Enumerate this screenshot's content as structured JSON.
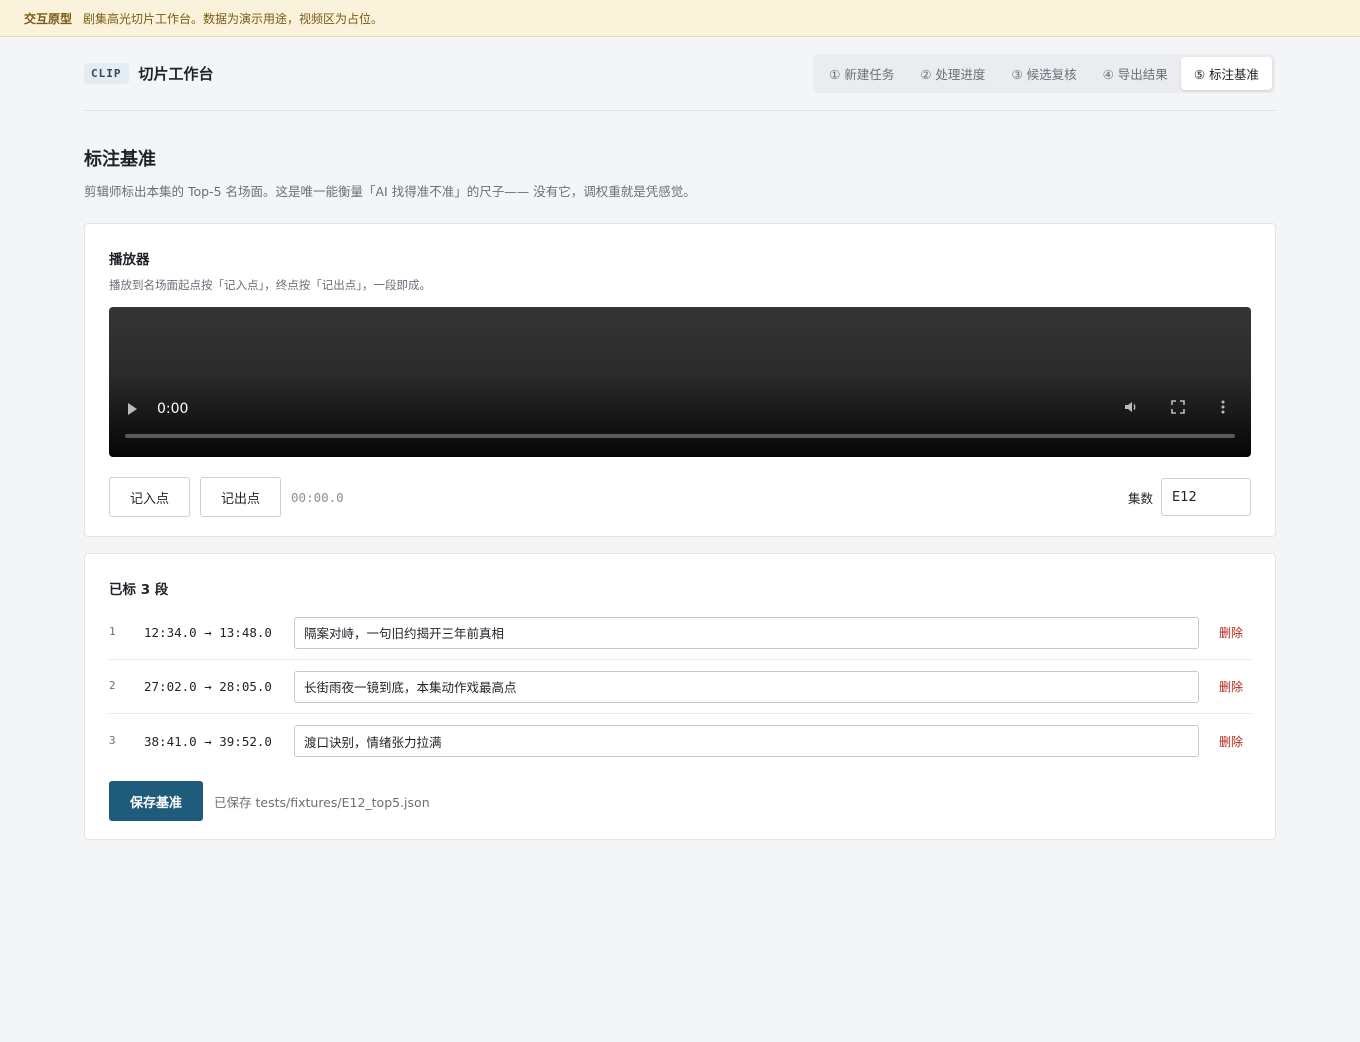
{
  "banner": {
    "tag": "交互原型",
    "message": "剧集高光切片工作台。数据为演示用途，视频区为占位。"
  },
  "header": {
    "brand_code": "CLIP",
    "app_name": "切片工作台",
    "tabs": [
      {
        "label": "① 新建任务",
        "active": false
      },
      {
        "label": "② 处理进度",
        "active": false
      },
      {
        "label": "③ 候选复核",
        "active": false
      },
      {
        "label": "④ 导出结果",
        "active": false
      },
      {
        "label": "⑤ 标注基准",
        "active": true
      }
    ]
  },
  "page": {
    "title": "标注基准",
    "description": "剪辑师标出本集的 Top-5 名场面。这是唯一能衡量「AI 找得准不准」的尺子—— 没有它，调权重就是凭感觉。"
  },
  "player": {
    "title": "播放器",
    "hint": "播放到名场面起点按「记入点」，终点按「记出点」，一段即成。",
    "video_time": "0:00",
    "mark_in_label": "记入点",
    "mark_out_label": "记出点",
    "current_timecode": "00:00.0",
    "episode_label": "集数",
    "episode_value": "E12"
  },
  "segments": {
    "title": "已标 3 段",
    "items": [
      {
        "index": "1",
        "range": "12:34.0 → 13:48.0",
        "title": "隔案对峙，一句旧约揭开三年前真相",
        "delete_label": "删除"
      },
      {
        "index": "2",
        "range": "27:02.0 → 28:05.0",
        "title": "长街雨夜一镜到底，本集动作戏最高点",
        "delete_label": "删除"
      },
      {
        "index": "3",
        "range": "38:41.0 → 39:52.0",
        "title": "渡口诀别，情绪张力拉满",
        "delete_label": "删除"
      }
    ],
    "save_label": "保存基准",
    "save_status": "已保存 tests/fixtures/E12_top5.json"
  }
}
